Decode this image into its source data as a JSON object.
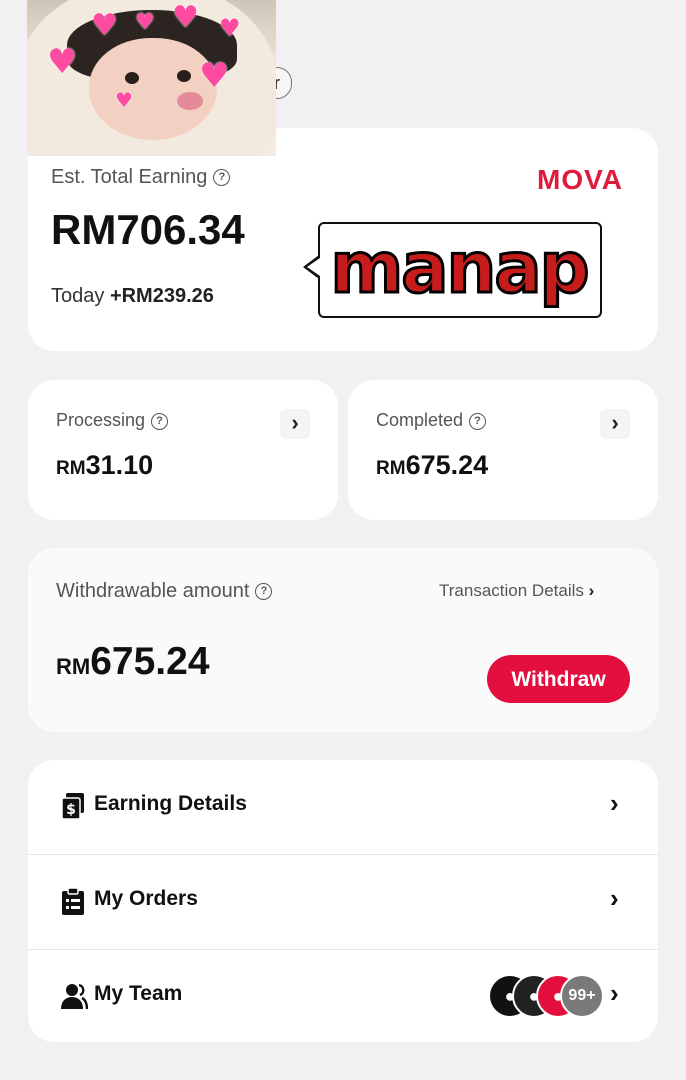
{
  "header": {
    "partial_button_label": "r"
  },
  "earning_card": {
    "title": "Est. Total Earning",
    "brand": "MOVA",
    "total_amount": "RM706.34",
    "today_label": "Today",
    "today_amount": "+RM239.26",
    "sticker_text": "manap"
  },
  "processing": {
    "label": "Processing",
    "currency": "RM",
    "amount": "31.10"
  },
  "completed": {
    "label": "Completed",
    "currency": "RM",
    "amount": "675.24"
  },
  "withdrawable": {
    "label": "Withdrawable amount",
    "transaction_link": "Transaction Details",
    "currency": "RM",
    "amount": "675.24",
    "withdraw_button": "Withdraw"
  },
  "menu": {
    "items": [
      {
        "label": "Earning Details",
        "icon": "earning-details-icon"
      },
      {
        "label": "My Orders",
        "icon": "clipboard-icon"
      },
      {
        "label": "My Team",
        "icon": "team-icon"
      }
    ],
    "team_badge": "99+"
  },
  "colors": {
    "accent": "#e30f3e",
    "background": "#f1f1f3",
    "card": "#ffffff"
  }
}
